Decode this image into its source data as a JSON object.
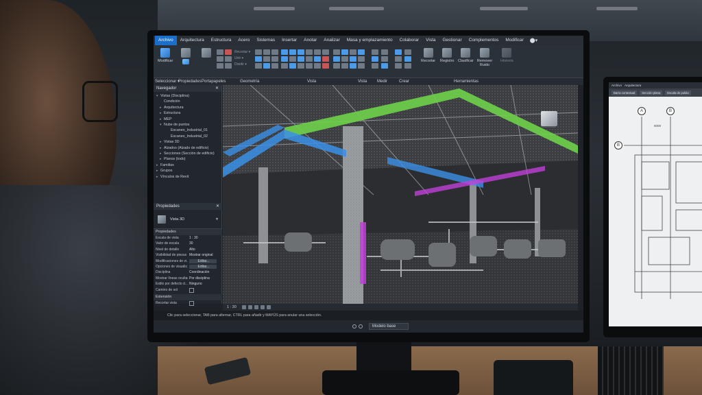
{
  "app": {
    "menu": [
      "Archivo",
      "Arquitectura",
      "Estructura",
      "Acero",
      "Sistemas",
      "Insertar",
      "Anotar",
      "Analizar",
      "Masa y emplazamiento",
      "Colaborar",
      "Vista",
      "Gestionar",
      "Complementos",
      "Modificar"
    ],
    "active_menu": "Archivo"
  },
  "ribbon": {
    "buttons": {
      "modificar": "Modificar",
      "recortar": "Recortar",
      "registro": "Registro",
      "clasificar": "Clasificar",
      "remover_ruido": "Remover Ruido",
      "historia": "Historia"
    },
    "dropdowns": {
      "recortar": "Recortar",
      "unir": "Unir",
      "dividir": "Dividir"
    },
    "panels": [
      "Seleccionar ▾",
      "Propiedades",
      "Portapapeles",
      "Geometría",
      "Vista",
      "Vista",
      "Medir",
      "Crear",
      "Herramientas"
    ]
  },
  "navigator": {
    "title": "Navegador",
    "close": "✕",
    "items": [
      {
        "label": "Vistas (Disciplina)",
        "indent": 0,
        "twisty": "▾"
      },
      {
        "label": "Condición",
        "indent": 1,
        "twisty": ""
      },
      {
        "label": "Arquitectura",
        "indent": 1,
        "twisty": "▸"
      },
      {
        "label": "Estructura",
        "indent": 1,
        "twisty": "▸"
      },
      {
        "label": "MEP",
        "indent": 1,
        "twisty": "▸"
      },
      {
        "label": "Nube de puntos",
        "indent": 1,
        "twisty": "▾"
      },
      {
        "label": "Escaneo_Industrial_01",
        "indent": 3,
        "twisty": ""
      },
      {
        "label": "Escaneo_Industrial_02",
        "indent": 3,
        "twisty": ""
      },
      {
        "label": "Vistas 3D",
        "indent": 1,
        "twisty": "▸"
      },
      {
        "label": "Alzados (Alzado de edificio)",
        "indent": 1,
        "twisty": "▸"
      },
      {
        "label": "Secciones (Sección de edificio)",
        "indent": 1,
        "twisty": "▸"
      },
      {
        "label": "Planos (todo)",
        "indent": 1,
        "twisty": "▸"
      },
      {
        "label": "Familias",
        "indent": 0,
        "twisty": "▸"
      },
      {
        "label": "Grupos",
        "indent": 0,
        "twisty": "▸"
      },
      {
        "label": "Vínculos de Revit",
        "indent": 0,
        "twisty": "▸"
      }
    ]
  },
  "properties": {
    "title": "Propiedades",
    "close": "✕",
    "type_label": "Vista 3D",
    "section": "Propiedades",
    "rows": [
      {
        "k": "Escala de vista",
        "v": "1 : 30",
        "kind": "text"
      },
      {
        "k": "Valor de escala",
        "v": "30",
        "kind": "text"
      },
      {
        "k": "Nivel de detalle",
        "v": "Alto",
        "kind": "text"
      },
      {
        "k": "Visibilidad de piezas",
        "v": "Mostrar original",
        "kind": "text"
      },
      {
        "k": "Modificaciones de vi...",
        "v": "Editar...",
        "kind": "btn"
      },
      {
        "k": "Opciones de visualiz...",
        "v": "Editar...",
        "kind": "btn"
      },
      {
        "k": "Disciplina",
        "v": "Coordinación",
        "kind": "text"
      },
      {
        "k": "Mostrar líneas ocultas",
        "v": "Por disciplina",
        "kind": "text"
      },
      {
        "k": "Estilo por defecto d...",
        "v": "Ninguno",
        "kind": "text"
      },
      {
        "k": "Camino de sol",
        "v": "",
        "kind": "chk"
      }
    ],
    "extension_title": "Extensión",
    "extension_rows": [
      {
        "k": "Recortar vista",
        "v": "",
        "kind": "chk"
      }
    ]
  },
  "viewport": {
    "scale": "1 : 30"
  },
  "status": {
    "hint": "Clic para seleccionar, TAB para alternar, CTRL para añadir y MAYÚS para anular una selección.",
    "model": "Modelo base"
  },
  "second_monitor": {
    "menu": [
      "Archivo",
      "Arquitectura"
    ],
    "tabs": [
      "Barra contextual",
      "Sección plana",
      "Escala de pulido"
    ],
    "grid_bubbles": [
      "A",
      "B",
      "B"
    ],
    "dimension": "6000"
  },
  "colors": {
    "accent": "#1b6fc9",
    "pipe_green": "#6fd14a",
    "pipe_blue": "#3b8fe6",
    "pipe_magenta": "#c040d8"
  }
}
